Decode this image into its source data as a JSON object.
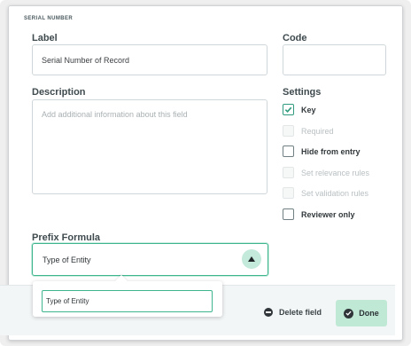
{
  "section": {
    "title": "SERIAL NUMBER"
  },
  "label_field": {
    "label": "Label",
    "value": "Serial Number of Record"
  },
  "code_field": {
    "label": "Code",
    "value": ""
  },
  "description_field": {
    "label": "Description",
    "placeholder": "Add additional information about this field"
  },
  "settings": {
    "title": "Settings",
    "items": [
      {
        "label": "Key",
        "checked": true,
        "disabled": false
      },
      {
        "label": "Required",
        "checked": false,
        "disabled": true
      },
      {
        "label": "Hide from entry",
        "checked": false,
        "disabled": false
      },
      {
        "label": "Set relevance rules",
        "checked": false,
        "disabled": true
      },
      {
        "label": "Set validation rules",
        "checked": false,
        "disabled": true
      },
      {
        "label": "Reviewer only",
        "checked": false,
        "disabled": false
      }
    ]
  },
  "prefix_formula": {
    "label": "Prefix Formula",
    "selected": "Type of Entity",
    "options": [
      "Type of Entity"
    ]
  },
  "footer": {
    "delete_label": "Delete field",
    "done_label": "Done"
  },
  "colors": {
    "accent": "#3fb58f",
    "accent_light": "#bfe8d5"
  }
}
